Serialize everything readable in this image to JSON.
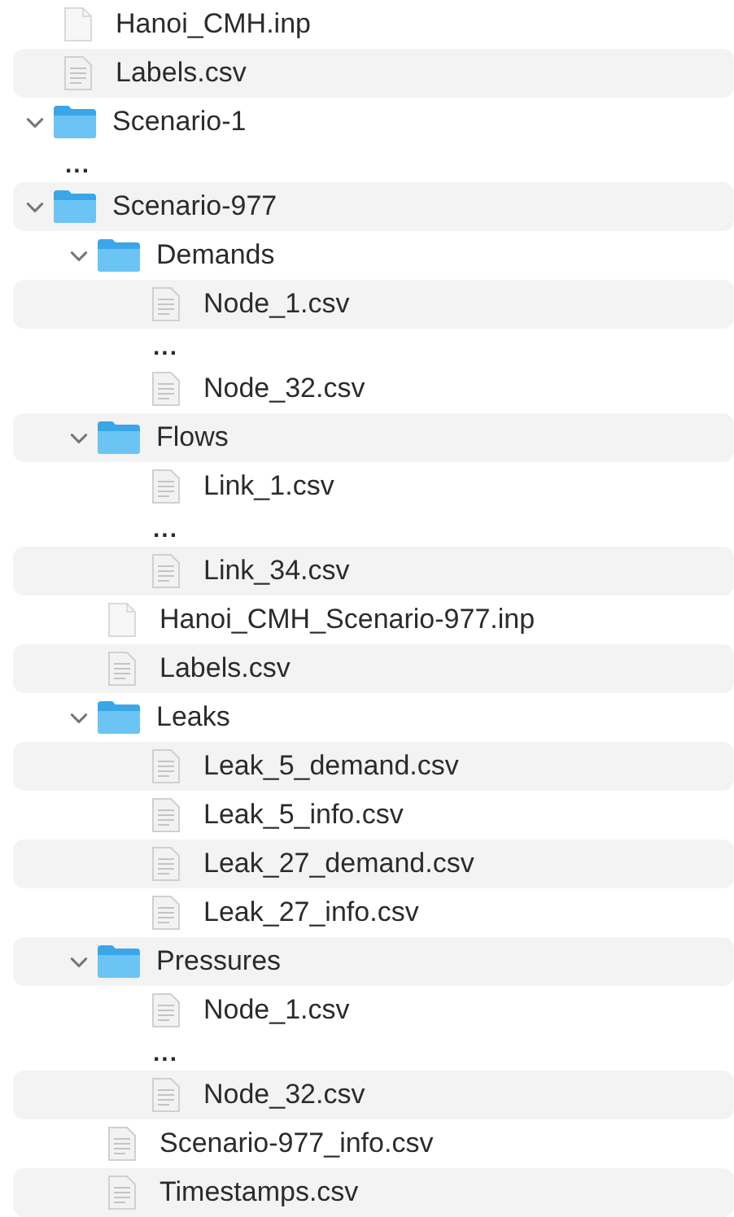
{
  "items": [
    {
      "kind": "file",
      "name": "Hanoi_CMH.inp"
    },
    {
      "kind": "document",
      "name": "Labels.csv"
    },
    {
      "kind": "folder",
      "name": "Scenario-1",
      "expanded": true
    },
    {
      "kind": "ellipsis",
      "name": "..."
    },
    {
      "kind": "folder",
      "name": "Scenario-977",
      "expanded": true,
      "children": [
        {
          "kind": "folder",
          "name": "Demands",
          "expanded": true,
          "children": [
            {
              "kind": "document",
              "name": "Node_1.csv"
            },
            {
              "kind": "ellipsis",
              "name": "..."
            },
            {
              "kind": "document",
              "name": "Node_32.csv"
            }
          ]
        },
        {
          "kind": "folder",
          "name": "Flows",
          "expanded": true,
          "children": [
            {
              "kind": "document",
              "name": "Link_1.csv"
            },
            {
              "kind": "ellipsis",
              "name": "..."
            },
            {
              "kind": "document",
              "name": "Link_34.csv"
            }
          ]
        },
        {
          "kind": "file",
          "name": "Hanoi_CMH_Scenario-977.inp"
        },
        {
          "kind": "document",
          "name": "Labels.csv"
        },
        {
          "kind": "folder",
          "name": "Leaks",
          "expanded": true,
          "children": [
            {
              "kind": "document",
              "name": "Leak_5_demand.csv"
            },
            {
              "kind": "document",
              "name": "Leak_5_info.csv"
            },
            {
              "kind": "document",
              "name": "Leak_27_demand.csv"
            },
            {
              "kind": "document",
              "name": "Leak_27_info.csv"
            }
          ]
        },
        {
          "kind": "folder",
          "name": "Pressures",
          "expanded": true,
          "children": [
            {
              "kind": "document",
              "name": "Node_1.csv"
            },
            {
              "kind": "ellipsis",
              "name": "..."
            },
            {
              "kind": "document",
              "name": "Node_32.csv"
            }
          ]
        },
        {
          "kind": "document",
          "name": "Scenario-977_info.csv"
        },
        {
          "kind": "document",
          "name": "Timestamps.csv"
        }
      ]
    }
  ]
}
